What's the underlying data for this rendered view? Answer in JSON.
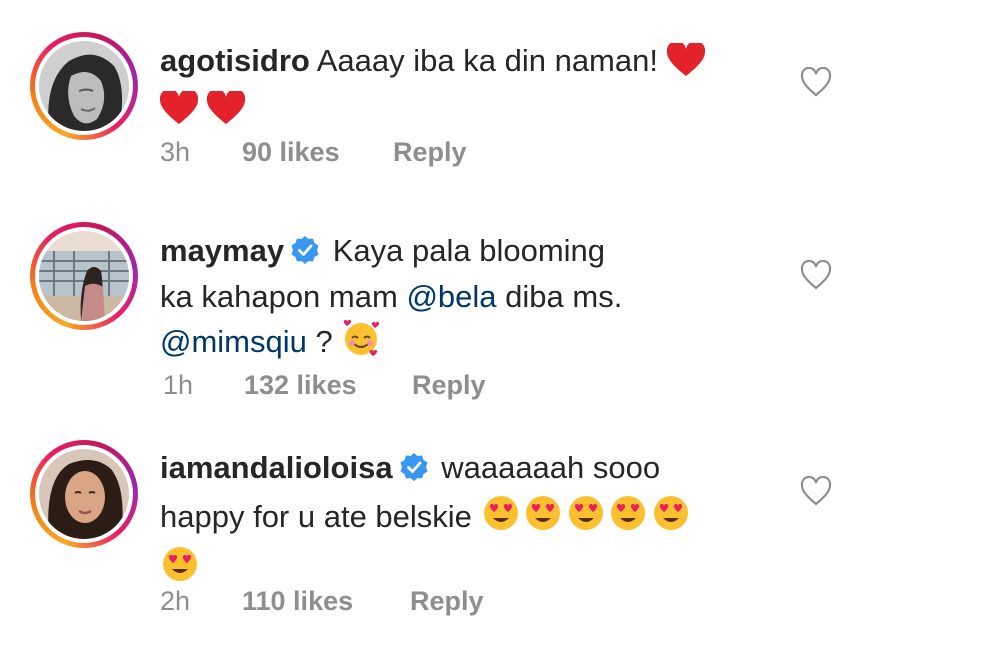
{
  "comments": [
    {
      "username": "agotisidro",
      "verified": false,
      "text": "Aaaay iba ka din naman!",
      "time": "3h",
      "likes": "90 likes",
      "reply": "Reply"
    },
    {
      "username": "maymay",
      "verified": true,
      "text1": "Kaya pala blooming",
      "text2": "ka kahapon mam",
      "mention1": "@bela",
      "text3": "diba ms.",
      "mention2": "@mimsqiu",
      "text4": "?",
      "time": "1h",
      "likes": "132 likes",
      "reply": "Reply"
    },
    {
      "username": "iamandalioloisa",
      "verified": true,
      "text1": "waaaaaah sooo",
      "text2": "happy for u ate belskie",
      "time": "2h",
      "likes": "110 likes",
      "reply": "Reply"
    }
  ],
  "colors": {
    "text": "#262626",
    "meta": "#8e8e8e",
    "mention": "#00376b",
    "verified": "#3897f0",
    "heart": "#ed1c24"
  },
  "icons": {
    "like": "heart-outline-icon",
    "verified": "verified-badge-icon"
  }
}
